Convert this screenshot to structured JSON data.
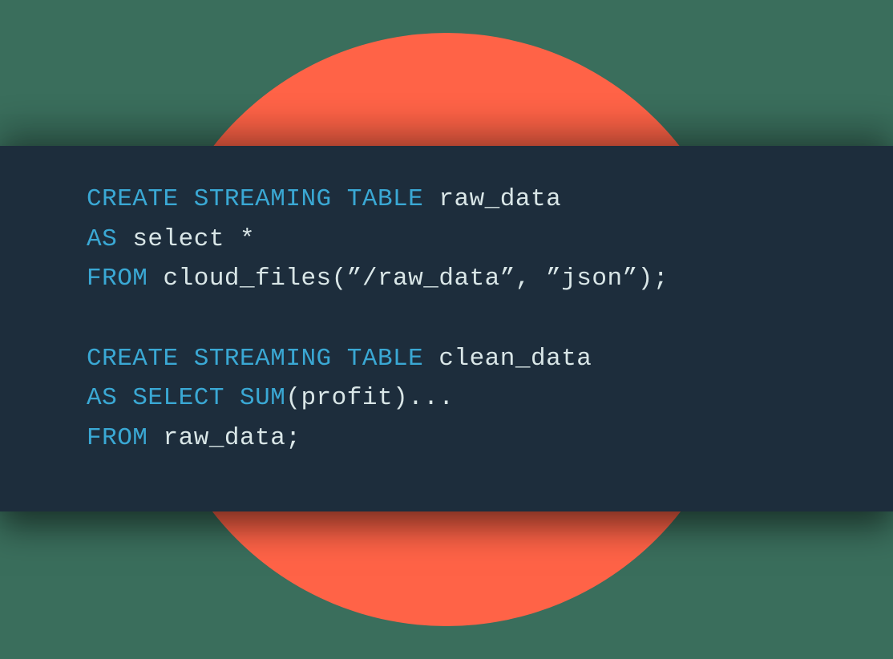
{
  "code": {
    "line1": {
      "kw1": "CREATE STREAMING TABLE ",
      "txt1": "raw_data"
    },
    "line2": {
      "kw1": "AS ",
      "txt1": "select *"
    },
    "line3": {
      "kw1": "FROM ",
      "txt1": "cloud_files(”/raw_data”, ”json”);"
    },
    "line4": {
      "kw1": "CREATE STREAMING TABLE ",
      "txt1": "clean_data"
    },
    "line5": {
      "kw1": "AS SELECT SUM",
      "txt1": "(profit)..."
    },
    "line6": {
      "kw1": "FROM ",
      "txt1": "raw_data;"
    }
  }
}
